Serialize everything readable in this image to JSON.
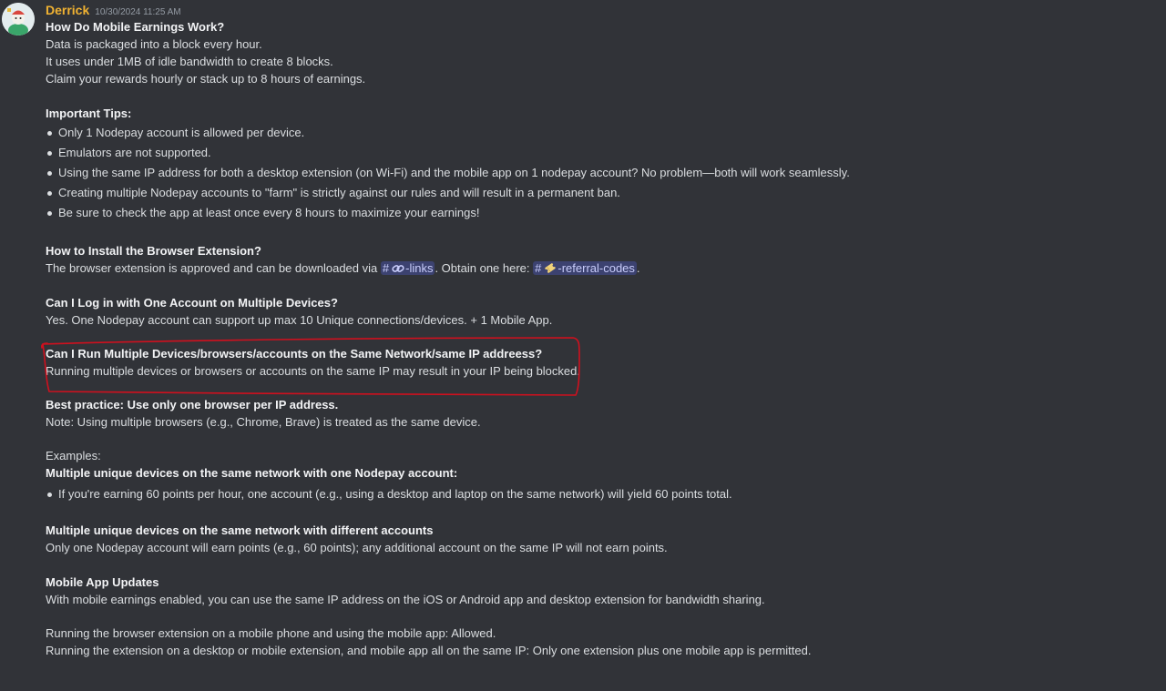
{
  "author": {
    "name": "Derrick",
    "timestamp": "10/30/2024 11:25 AM"
  },
  "message": {
    "q1_title": "How Do Mobile Earnings Work?",
    "q1_l1": "Data is packaged into a block every hour.",
    "q1_l2": "It uses under 1MB of idle bandwidth to create 8 blocks.",
    "q1_l3": "Claim your rewards hourly or stack up to 8 hours of earnings.",
    "tips_title": "Important Tips:",
    "tips": [
      "Only 1 Nodepay account is allowed per device.",
      "Emulators are not supported.",
      "Using the same IP address for both a desktop extension (on Wi-Fi) and the mobile app on 1 nodepay account? No problem—both will work seamlessly.",
      "Creating multiple Nodepay accounts to \"farm\" is strictly against our rules and will result in a permanent ban.",
      "Be sure to check the app at least once every 8 hours to maximize your earnings!"
    ],
    "install_title": "How to Install the Browser Extension?",
    "install_pre": "The browser extension is approved and can be downloaded via",
    "install_mid": ". Obtain one here:",
    "install_end": ".",
    "channel_links": "-links",
    "channel_referral": "-referral-codes",
    "login_title": "Can I Log in with One Account on Multiple Devices?",
    "login_text": "Yes. One Nodepay account can support up max 10 Unique connections/devices. + 1 Mobile App.",
    "multi_title": "Can I Run Multiple Devices/browsers/accounts on the Same Network/same IP addreess?",
    "multi_text": "Running multiple devices or browsers or accounts on the same IP may result in your IP being blocked.",
    "best_title": "Best practice: Use only one browser per IP address.",
    "best_text": "Note: Using multiple browsers (e.g., Chrome, Brave) is treated as the same device.",
    "examples_label": "Examples:",
    "ex1_title": "Multiple unique devices on the same network with one Nodepay account:",
    "ex1_bullet": "If you're earning 60 points per hour, one account (e.g., using a desktop and laptop on the same network) will yield 60 points total.",
    "ex2_title": "Multiple unique devices on the same network with different accounts",
    "ex2_text": "Only one Nodepay account will earn points (e.g., 60 points); any additional account on the same IP will not earn points.",
    "mobile_title": "Mobile App Updates",
    "mobile_text": "With mobile earnings enabled, you can use the same IP address on the iOS or Android app and desktop extension for bandwidth sharing.",
    "run1": "Running the browser extension on a mobile phone and using the mobile app: Allowed.",
    "run2": "Running the extension on a desktop or mobile extension, and mobile app all on the same IP: Only one extension plus one mobile app is permitted."
  },
  "colors": {
    "background": "#313338",
    "username": "#f0b232",
    "mention_bg": "#3c4270",
    "mention_text": "#c9cdfb",
    "annotation": "#d0101e"
  },
  "icons": {
    "avatar": "cartoon-avatar",
    "links_channel": "link-icon",
    "referral_channel": "ticket-icon"
  }
}
